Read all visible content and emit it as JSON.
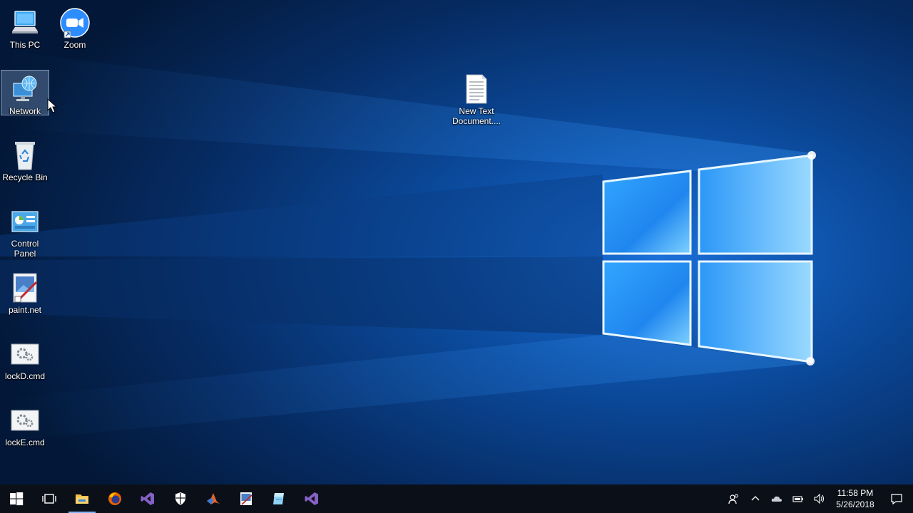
{
  "desktop": {
    "icons": [
      {
        "id": "this-pc",
        "label": "This PC",
        "icon": "computer-icon"
      },
      {
        "id": "zoom",
        "label": "Zoom",
        "icon": "zoom-camera-icon"
      },
      {
        "id": "network",
        "label": "Network",
        "icon": "network-globe-icon",
        "selected": true
      },
      {
        "id": "new-text-document",
        "label": "New Text\nDocument....",
        "icon": "text-file-icon"
      },
      {
        "id": "recycle-bin",
        "label": "Recycle Bin",
        "icon": "recycle-bin-icon"
      },
      {
        "id": "control-panel",
        "label": "Control\nPanel",
        "icon": "control-panel-icon"
      },
      {
        "id": "paint-net",
        "label": "paint.net",
        "icon": "paint-net-icon"
      },
      {
        "id": "lockd-cmd",
        "label": "lockD.cmd",
        "icon": "cmd-script-icon"
      },
      {
        "id": "locke-cmd",
        "label": "lockE.cmd",
        "icon": "cmd-script-icon"
      }
    ]
  },
  "taskbar": {
    "pinned": [
      {
        "id": "start",
        "icon": "windows-start-icon"
      },
      {
        "id": "task-view",
        "icon": "task-view-icon"
      },
      {
        "id": "file-explorer",
        "icon": "folder-icon",
        "active": true
      },
      {
        "id": "firefox",
        "icon": "firefox-icon"
      },
      {
        "id": "visual-studio",
        "icon": "visual-studio-icon"
      },
      {
        "id": "windows-security",
        "icon": "shield-icon"
      },
      {
        "id": "matlab",
        "icon": "matlab-icon"
      },
      {
        "id": "paint-net",
        "icon": "paint-net-icon"
      },
      {
        "id": "notepad",
        "icon": "notepad-icon"
      },
      {
        "id": "visual-studio-2",
        "icon": "visual-studio-icon"
      }
    ],
    "tray": [
      {
        "id": "people",
        "icon": "people-icon"
      },
      {
        "id": "show-hidden",
        "icon": "chevron-up-icon"
      },
      {
        "id": "onedrive",
        "icon": "cloud-icon"
      },
      {
        "id": "battery",
        "icon": "battery-icon"
      },
      {
        "id": "volume",
        "icon": "speaker-icon"
      }
    ],
    "clock": {
      "time": "11:58 PM",
      "date": "5/26/2018"
    },
    "notifications_icon": "action-center-icon"
  },
  "colors": {
    "wallpaper_dark": "#031a3c",
    "wallpaper_light": "#1e8fff",
    "taskbar": "#0b0f18",
    "accent": "#7fb4f0"
  }
}
